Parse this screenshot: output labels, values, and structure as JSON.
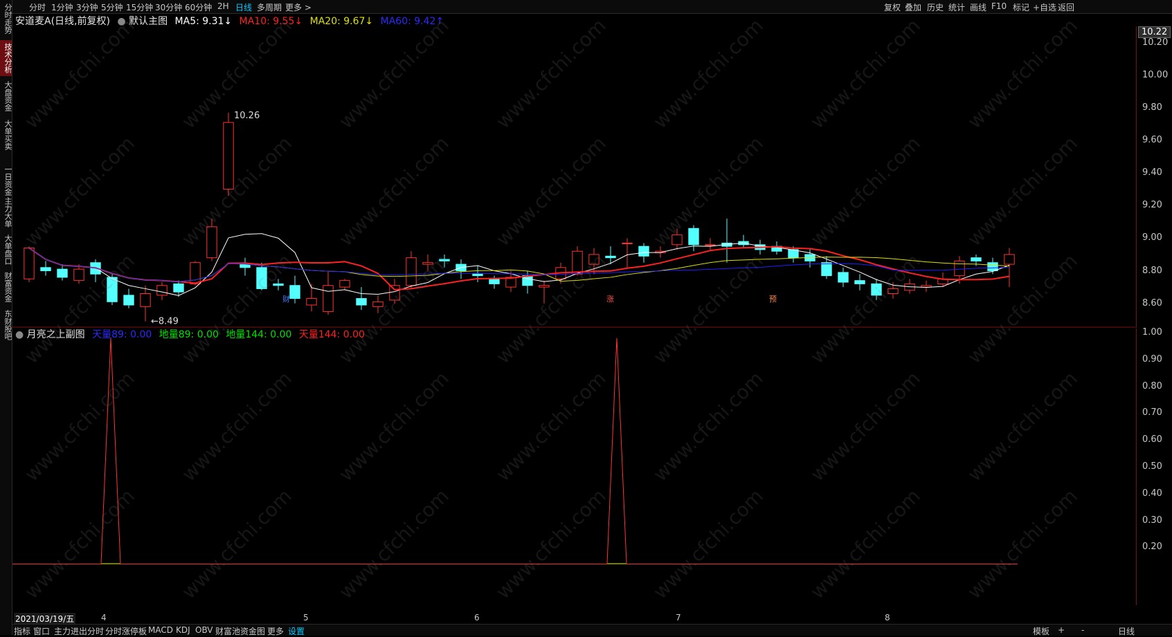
{
  "sidebar": {
    "items": [
      {
        "label": "分时走势",
        "active": false
      },
      {
        "label": "技术分析",
        "active": true
      },
      {
        "label": "大盘资金",
        "active": false
      },
      {
        "label": "大单买卖",
        "active": false
      },
      {
        "label": "一日资金",
        "active": false
      },
      {
        "label": "主力大单",
        "active": false
      },
      {
        "label": "大单盘口",
        "active": false
      },
      {
        "label": "财富资金",
        "active": false
      },
      {
        "label": "东财股吧",
        "active": false
      }
    ]
  },
  "toolbar": {
    "periods": [
      "分时",
      "1分钟",
      "3分钟",
      "5分钟",
      "15分钟",
      "30分钟",
      "60分钟",
      "2H",
      "日线",
      "多周期",
      "更多 >"
    ],
    "active_period": "日线",
    "right": [
      "复权",
      "叠加",
      "历史",
      "统计",
      "画线",
      "F10",
      "标记",
      "+自选",
      "返回"
    ]
  },
  "main_header": {
    "stock": "安道麦A(日线,前复权)",
    "template": "默认主图",
    "ma5": "MA5: 9.31↓",
    "ma10": "MA10: 9.55↓",
    "ma20": "MA20: 9.67↓",
    "ma60": "MA60: 9.42↑"
  },
  "sub_header": {
    "title": "月亮之上副图",
    "tian89": "天量89: 0.00",
    "di89": "地量89: 0.00",
    "di144": "地量144: 0.00",
    "tian144": "天量144: 0.00"
  },
  "price_axis": {
    "current": "10.22",
    "ticks": [
      "10.20",
      "10.00",
      "9.80",
      "9.60",
      "9.40",
      "9.20",
      "9.00",
      "8.80",
      "8.60"
    ]
  },
  "sub_axis": {
    "ticks": [
      "1.00",
      "0.90",
      "0.80",
      "0.70",
      "0.60",
      "0.50",
      "0.40",
      "0.30",
      "0.20"
    ]
  },
  "annotations": {
    "high": "10.26",
    "low": "8.49",
    "markers": [
      "财",
      "涨",
      "预"
    ]
  },
  "date_bar": {
    "date": "2021/03/19/五",
    "months": [
      "4",
      "5",
      "6",
      "7",
      "8"
    ]
  },
  "bottom_bar": {
    "tabs": [
      "指标",
      "窗口",
      "主力进出分时",
      "分时涨停板",
      "MACD",
      "KDJ",
      "OBV",
      "财富池资金图",
      "更多",
      "设置"
    ],
    "active_tab": "设置",
    "right": [
      "模板",
      "+",
      "-",
      "日线"
    ]
  },
  "watermark": "www.cfchi.com",
  "colors": {
    "up": "#ff3232",
    "down": "#54ffff",
    "ma5": "#ffffff",
    "ma10": "#ff2020",
    "ma20": "#e0e000",
    "ma60": "#2020ff"
  },
  "chart_data": {
    "type": "candlestick",
    "series": [
      {
        "name": "MA5",
        "values": []
      },
      {
        "name": "MA10",
        "values": []
      },
      {
        "name": "MA20",
        "values": []
      },
      {
        "name": "MA60",
        "values": []
      }
    ],
    "ylim": [
      8.45,
      10.3
    ],
    "candles": [
      [
        8.75,
        8.94,
        8.73,
        8.95
      ],
      [
        8.82,
        8.8,
        8.77,
        8.86
      ],
      [
        8.81,
        8.76,
        8.74,
        8.84
      ],
      [
        8.74,
        8.81,
        8.72,
        8.84
      ],
      [
        8.85,
        8.78,
        8.73,
        8.87
      ],
      [
        8.76,
        8.61,
        8.59,
        8.78
      ],
      [
        8.65,
        8.59,
        8.57,
        8.69
      ],
      [
        8.58,
        8.66,
        8.49,
        8.71
      ],
      [
        8.65,
        8.71,
        8.62,
        8.73
      ],
      [
        8.72,
        8.67,
        8.64,
        8.74
      ],
      [
        8.72,
        8.85,
        8.71,
        8.86
      ],
      [
        8.88,
        9.07,
        8.86,
        9.12
      ],
      [
        9.3,
        9.71,
        9.26,
        9.77
      ],
      [
        8.84,
        8.82,
        8.77,
        8.88
      ],
      [
        8.82,
        8.69,
        8.68,
        8.85
      ],
      [
        8.72,
        8.71,
        8.68,
        8.75
      ],
      [
        8.71,
        8.63,
        8.6,
        8.77
      ],
      [
        8.59,
        8.63,
        8.55,
        8.72
      ],
      [
        8.55,
        8.71,
        8.53,
        8.8
      ],
      [
        8.7,
        8.74,
        8.68,
        8.75
      ],
      [
        8.63,
        8.59,
        8.56,
        8.7
      ],
      [
        8.58,
        8.61,
        8.54,
        8.65
      ],
      [
        8.62,
        8.71,
        8.6,
        8.75
      ],
      [
        8.71,
        8.88,
        8.69,
        8.92
      ],
      [
        8.84,
        8.85,
        8.8,
        8.9
      ],
      [
        8.87,
        8.86,
        8.82,
        8.9
      ],
      [
        8.84,
        8.8,
        8.75,
        8.87
      ],
      [
        8.78,
        8.77,
        8.73,
        8.83
      ],
      [
        8.75,
        8.72,
        8.69,
        8.77
      ],
      [
        8.7,
        8.76,
        8.67,
        8.8
      ],
      [
        8.77,
        8.71,
        8.66,
        8.8
      ],
      [
        8.7,
        8.71,
        8.6,
        8.74
      ],
      [
        8.75,
        8.82,
        8.72,
        8.85
      ],
      [
        8.78,
        8.92,
        8.77,
        8.95
      ],
      [
        8.84,
        8.9,
        8.78,
        8.94
      ],
      [
        8.89,
        8.88,
        8.84,
        8.95
      ],
      [
        8.97,
        8.97,
        8.82,
        9.0
      ],
      [
        8.95,
        8.89,
        8.85,
        8.97
      ],
      [
        8.91,
        8.92,
        8.88,
        8.95
      ],
      [
        8.96,
        9.02,
        8.93,
        9.06
      ],
      [
        9.06,
        8.96,
        8.92,
        9.08
      ],
      [
        8.96,
        8.96,
        8.92,
        9.0
      ],
      [
        8.97,
        8.95,
        8.85,
        9.12
      ],
      [
        8.98,
        8.96,
        8.94,
        9.02
      ],
      [
        8.96,
        8.93,
        8.9,
        8.99
      ],
      [
        8.95,
        8.92,
        8.9,
        8.98
      ],
      [
        8.93,
        8.88,
        8.85,
        8.95
      ],
      [
        8.9,
        8.86,
        8.82,
        8.94
      ],
      [
        8.85,
        8.77,
        8.75,
        8.89
      ],
      [
        8.79,
        8.73,
        8.7,
        8.82
      ],
      [
        8.74,
        8.72,
        8.68,
        8.78
      ],
      [
        8.72,
        8.65,
        8.62,
        8.75
      ],
      [
        8.66,
        8.69,
        8.63,
        8.73
      ],
      [
        8.68,
        8.72,
        8.66,
        8.75
      ],
      [
        8.7,
        8.71,
        8.67,
        8.74
      ],
      [
        8.72,
        8.75,
        8.7,
        8.79
      ],
      [
        8.77,
        8.86,
        8.72,
        8.89
      ],
      [
        8.88,
        8.86,
        8.83,
        8.9
      ],
      [
        8.85,
        8.8,
        8.78,
        8.88
      ],
      [
        8.84,
        8.9,
        8.7,
        8.94
      ]
    ],
    "pulses": [
      0.98,
      0.98
    ]
  }
}
